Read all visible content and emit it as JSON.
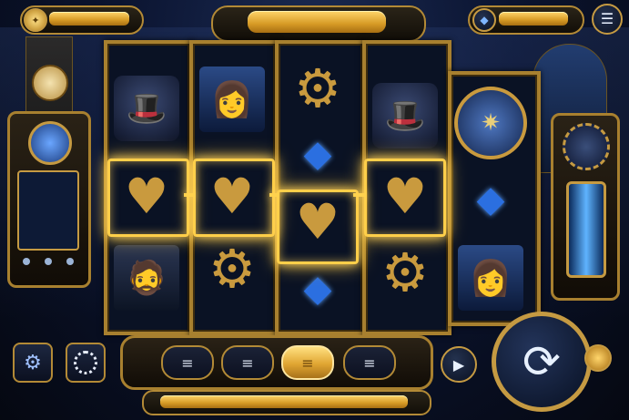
{
  "header": {
    "coin_icon": "coin-icon",
    "gem_icon": "diamond-icon",
    "menu_icon": "menu-icon"
  },
  "reels": [
    [
      "top-hat-goggles",
      "golden-heart",
      "gentleman-portrait"
    ],
    [
      "lady-portrait",
      "golden-heart",
      "gear-wheel"
    ],
    [
      "gear-wheel",
      "blue-gem",
      "golden-heart",
      "blue-gem"
    ],
    [
      "top-hat-goggles",
      "golden-heart",
      "gear-wheel"
    ],
    [
      "compass-clock",
      "blue-gem",
      "lady-portrait"
    ]
  ],
  "winline": {
    "symbol": "golden-heart",
    "reels": [
      1,
      2,
      3,
      4
    ]
  },
  "controls": {
    "settings_icon": "gear-icon",
    "autoplay_icon": "autoplay-icon",
    "bet_chips": [
      {
        "icon": "coin-stack-icon",
        "active": false
      },
      {
        "icon": "coin-stack-icon",
        "active": false
      },
      {
        "icon": "coin-stack-icon",
        "active": true
      },
      {
        "icon": "coin-stack-icon",
        "active": false
      }
    ],
    "play_icon": "play-icon",
    "spin_icon": "spin-arrows-icon"
  },
  "colors": {
    "gold": "#c59a42",
    "highlight": "#ffd24e",
    "blue": "#2b6fe0",
    "bg": "#070b18"
  }
}
